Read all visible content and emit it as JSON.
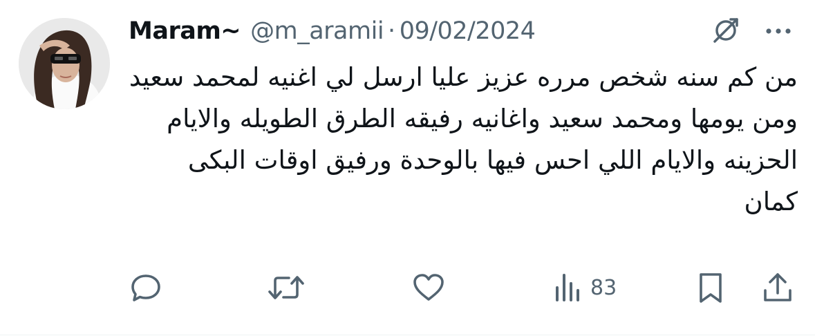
{
  "author": {
    "display_name": "Maram~",
    "handle": "@m_aramii",
    "separator": "·",
    "date": "09/02/2024"
  },
  "tweet": {
    "paragraphs": [
      "من كم سنه شخص مرره عزيز عليا ارسل لي اغنيه لمحمد سعيد",
      "ومن يومها ومحمد سعيد واغانيه رفيقه الطرق الطويله والايام الحزينه والايام اللي احس فيها بالوحدة ورفيق اوقات البكى كمان"
    ]
  },
  "actions": {
    "views_count": "83"
  },
  "icons": {
    "avatar": "profile-photo",
    "grok": "grok-icon",
    "more": "more-icon",
    "reply": "reply-icon",
    "retweet": "retweet-icon",
    "like": "heart-icon",
    "views": "views-icon",
    "bookmark": "bookmark-icon",
    "share": "share-icon"
  },
  "colors": {
    "text_primary": "#0f1419",
    "text_secondary": "#536471",
    "divider": "#eff3f4"
  }
}
